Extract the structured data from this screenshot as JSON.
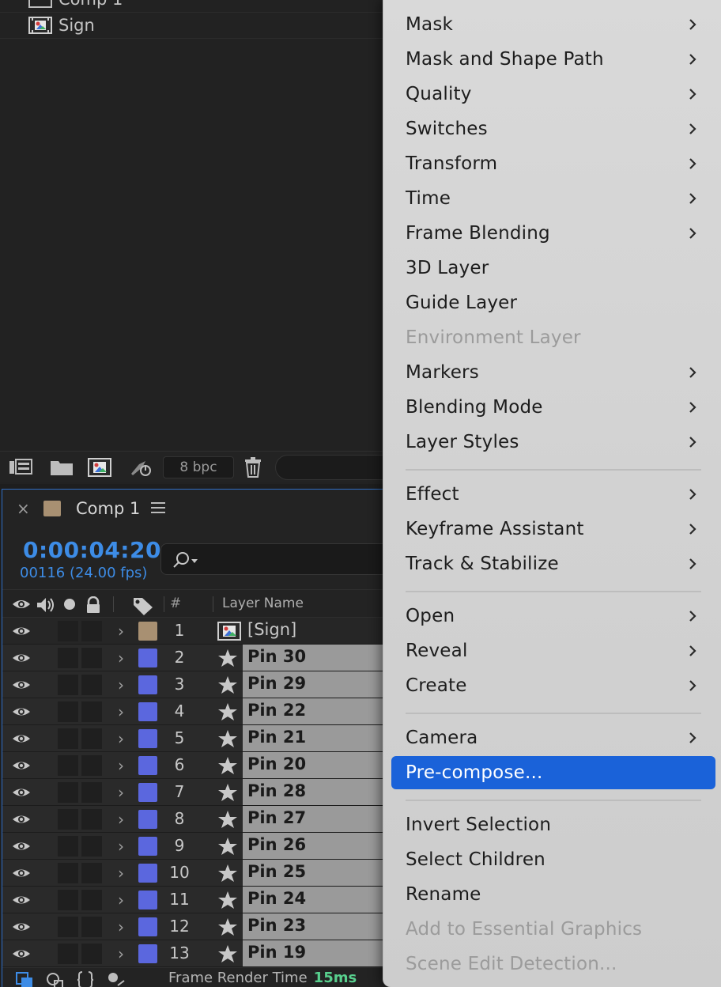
{
  "project_panel": {
    "items": [
      {
        "label": "Comp 1",
        "icon": "composition-icon"
      },
      {
        "label": "Sign",
        "icon": "footage-icon"
      }
    ],
    "toolbar": {
      "bpc_label": "8 bpc"
    }
  },
  "timeline": {
    "tab_title": "Comp 1",
    "timecode": "0:00:04:20",
    "frame_info": "00116 (24.00 fps)",
    "columns": {
      "number": "#",
      "layer_name": "Layer Name"
    },
    "layers": [
      {
        "num": "1",
        "name": "[Sign]",
        "color": "#a89072",
        "type": "footage"
      },
      {
        "num": "2",
        "name": "Pin 30",
        "color": "#5b67de",
        "type": "shape"
      },
      {
        "num": "3",
        "name": "Pin 29",
        "color": "#5b67de",
        "type": "shape"
      },
      {
        "num": "4",
        "name": "Pin 22",
        "color": "#5b67de",
        "type": "shape"
      },
      {
        "num": "5",
        "name": "Pin 21",
        "color": "#5b67de",
        "type": "shape"
      },
      {
        "num": "6",
        "name": "Pin 20",
        "color": "#5b67de",
        "type": "shape"
      },
      {
        "num": "7",
        "name": "Pin 28",
        "color": "#5b67de",
        "type": "shape"
      },
      {
        "num": "8",
        "name": "Pin 27",
        "color": "#5b67de",
        "type": "shape"
      },
      {
        "num": "9",
        "name": "Pin 26",
        "color": "#5b67de",
        "type": "shape"
      },
      {
        "num": "10",
        "name": "Pin 25",
        "color": "#5b67de",
        "type": "shape"
      },
      {
        "num": "11",
        "name": "Pin 24",
        "color": "#5b67de",
        "type": "shape"
      },
      {
        "num": "12",
        "name": "Pin 23",
        "color": "#5b67de",
        "type": "shape"
      },
      {
        "num": "13",
        "name": "Pin 19",
        "color": "#5b67de",
        "type": "shape"
      }
    ],
    "footer": {
      "render_label": "Frame Render Time",
      "render_value": "15ms"
    }
  },
  "context_menu": {
    "groups": [
      [
        {
          "label": "Mask",
          "submenu": true
        },
        {
          "label": "Mask and Shape Path",
          "submenu": true
        },
        {
          "label": "Quality",
          "submenu": true
        },
        {
          "label": "Switches",
          "submenu": true
        },
        {
          "label": "Transform",
          "submenu": true
        },
        {
          "label": "Time",
          "submenu": true
        },
        {
          "label": "Frame Blending",
          "submenu": true
        },
        {
          "label": "3D Layer",
          "submenu": false
        },
        {
          "label": "Guide Layer",
          "submenu": false
        },
        {
          "label": "Environment Layer",
          "submenu": false,
          "disabled": true
        },
        {
          "label": "Markers",
          "submenu": true
        },
        {
          "label": "Blending Mode",
          "submenu": true
        },
        {
          "label": "Layer Styles",
          "submenu": true
        }
      ],
      [
        {
          "label": "Effect",
          "submenu": true
        },
        {
          "label": "Keyframe Assistant",
          "submenu": true
        },
        {
          "label": "Track & Stabilize",
          "submenu": true
        }
      ],
      [
        {
          "label": "Open",
          "submenu": true
        },
        {
          "label": "Reveal",
          "submenu": true
        },
        {
          "label": "Create",
          "submenu": true
        }
      ],
      [
        {
          "label": "Camera",
          "submenu": true
        },
        {
          "label": "Pre-compose...",
          "submenu": false,
          "selected": true
        }
      ],
      [
        {
          "label": "Invert Selection",
          "submenu": false
        },
        {
          "label": "Select Children",
          "submenu": false
        },
        {
          "label": "Rename",
          "submenu": false
        },
        {
          "label": "Add to Essential Graphics",
          "submenu": false,
          "disabled": true
        },
        {
          "label": "Scene Edit Detection...",
          "submenu": false,
          "disabled": true
        }
      ]
    ]
  }
}
